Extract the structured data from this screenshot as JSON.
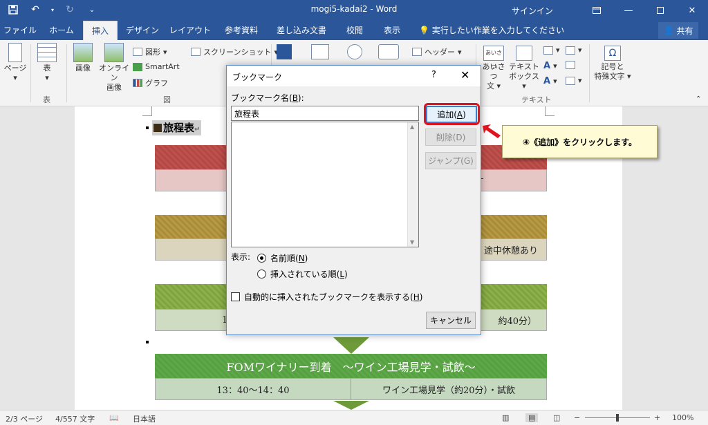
{
  "window": {
    "title": "mogi5-kadai2  -  Word",
    "signin": "サインイン",
    "share": "共有"
  },
  "tabs": [
    "ファイル",
    "ホーム",
    "挿入",
    "デザイン",
    "レイアウト",
    "参考資料",
    "差し込み文書",
    "校閲",
    "表示"
  ],
  "active_tab": "挿入",
  "tellme": "実行したい作業を入力してください",
  "ribbon": {
    "page_label": "ページ",
    "table_label": "表",
    "table_group": "表",
    "picture": "画像",
    "online_picture_1": "オンライン",
    "online_picture_2": "画像",
    "shapes": "図形",
    "smartart": "SmartArt",
    "chart": "グラフ",
    "screenshot": "スクリーンショット",
    "illust_group": "図",
    "header": "ヘッダー",
    "greeting_1": "あいさつ",
    "greeting_2": "文",
    "textbox_1": "テキスト",
    "textbox_2": "ボックス",
    "text_group": "テキスト",
    "symbol_1": "記号と",
    "symbol_2": "特殊文字",
    "greeting_icon": "あいさつ"
  },
  "document": {
    "heading": "旅程表",
    "row1_right": "す",
    "row2_right": "途中休憩あり",
    "row3_left": "1",
    "row3_right": "約40分）",
    "band4_title": "FOMワイナリー到着　～ワイン工場見学・試飲～",
    "band4_left": "13：40～14：40",
    "band4_right": "ワイン工場見学（約20分）・試飲"
  },
  "dialog": {
    "title": "ブックマーク",
    "help": "?",
    "name_label_pre": "ブックマーク名(",
    "name_label_key": "B",
    "name_label_post": "):",
    "name_value": "旅程表",
    "add_pre": "追加(",
    "add_key": "A",
    "add_post": ")",
    "delete_label": "削除(D)",
    "jump_label": "ジャンプ(G)",
    "sort_label": "表示:",
    "sort_name_pre": "名前順(",
    "sort_name_key": "N",
    "sort_name_post": ")",
    "sort_location_pre": "挿入されている順(",
    "sort_location_key": "L",
    "sort_location_post": ")",
    "hidden_pre": "自動的に挿入されたブックマークを表示する(",
    "hidden_key": "H",
    "hidden_post": ")",
    "cancel_label": "キャンセル"
  },
  "callout": "④《追加》をクリックします。",
  "status": {
    "page": "2/3 ページ",
    "words": "4/557 文字",
    "language": "日本語",
    "zoom": "100%"
  },
  "colors": {
    "accent": "#2b579a",
    "band1": "#c0504d",
    "band2": "#b89a42",
    "band3": "#8db04a",
    "band4": "#5fa84a",
    "callout_bg": "#fffcd5",
    "highlight": "#e0141e"
  }
}
